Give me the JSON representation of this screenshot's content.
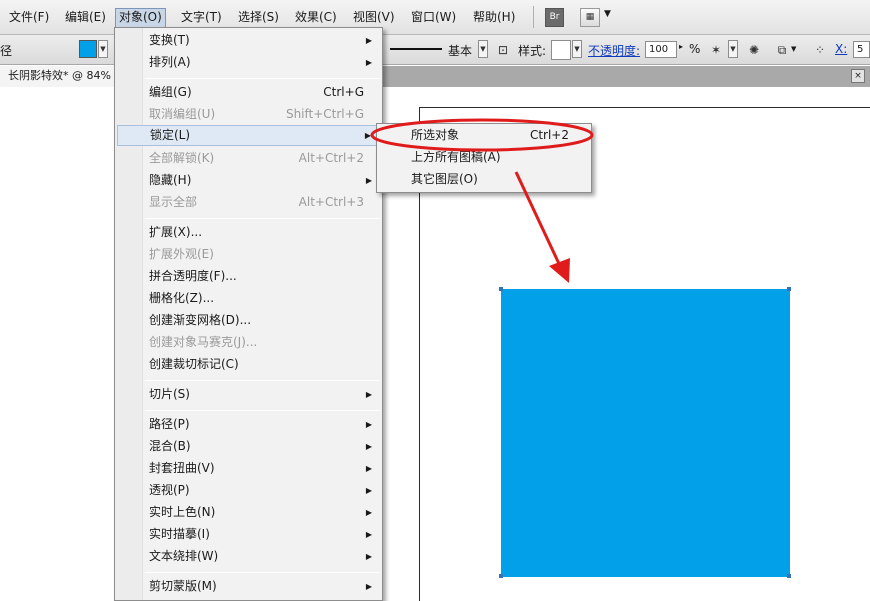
{
  "menubar": {
    "items": [
      "文件(F)",
      "编辑(E)",
      "对象(O)",
      "文字(T)",
      "选择(S)",
      "效果(C)",
      "视图(V)",
      "窗口(W)",
      "帮助(H)"
    ],
    "bridge_icon": "Br",
    "arrange_icon": "▦"
  },
  "controlbar": {
    "stroke_label_partial": "径",
    "brush_value": "基本",
    "style_label": "样式:",
    "opacity_label": "不透明度:",
    "opacity_value": "100",
    "opacity_unit": "%",
    "x_label": "X:",
    "x_value_partial": "5"
  },
  "document": {
    "tab_title": "长阴影特效* @ 84%",
    "close_glyph": "×"
  },
  "object_menu": {
    "items": [
      {
        "label": "变换(T)",
        "shortcut": "",
        "submenu": true,
        "disabled": false
      },
      {
        "label": "排列(A)",
        "shortcut": "",
        "submenu": true,
        "disabled": false
      },
      {
        "label": "编组(G)",
        "shortcut": "Ctrl+G",
        "submenu": false,
        "disabled": false
      },
      {
        "label": "取消编组(U)",
        "shortcut": "Shift+Ctrl+G",
        "submenu": false,
        "disabled": true
      },
      {
        "label": "锁定(L)",
        "shortcut": "",
        "submenu": true,
        "disabled": false
      },
      {
        "label": "全部解锁(K)",
        "shortcut": "Alt+Ctrl+2",
        "submenu": false,
        "disabled": true
      },
      {
        "label": "隐藏(H)",
        "shortcut": "",
        "submenu": true,
        "disabled": false
      },
      {
        "label": "显示全部",
        "shortcut": "Alt+Ctrl+3",
        "submenu": false,
        "disabled": true
      },
      {
        "label": "扩展(X)...",
        "shortcut": "",
        "submenu": false,
        "disabled": false
      },
      {
        "label": "扩展外观(E)",
        "shortcut": "",
        "submenu": false,
        "disabled": true
      },
      {
        "label": "拼合透明度(F)...",
        "shortcut": "",
        "submenu": false,
        "disabled": false
      },
      {
        "label": "栅格化(Z)...",
        "shortcut": "",
        "submenu": false,
        "disabled": false
      },
      {
        "label": "创建渐变网格(D)...",
        "shortcut": "",
        "submenu": false,
        "disabled": false
      },
      {
        "label": "创建对象马赛克(J)...",
        "shortcut": "",
        "submenu": false,
        "disabled": true
      },
      {
        "label": "创建裁切标记(C)",
        "shortcut": "",
        "submenu": false,
        "disabled": false
      },
      {
        "label": "切片(S)",
        "shortcut": "",
        "submenu": true,
        "disabled": false
      },
      {
        "label": "路径(P)",
        "shortcut": "",
        "submenu": true,
        "disabled": false
      },
      {
        "label": "混合(B)",
        "shortcut": "",
        "submenu": true,
        "disabled": false
      },
      {
        "label": "封套扭曲(V)",
        "shortcut": "",
        "submenu": true,
        "disabled": false
      },
      {
        "label": "透视(P)",
        "shortcut": "",
        "submenu": true,
        "disabled": false
      },
      {
        "label": "实时上色(N)",
        "shortcut": "",
        "submenu": true,
        "disabled": false
      },
      {
        "label": "实时描摹(I)",
        "shortcut": "",
        "submenu": true,
        "disabled": false
      },
      {
        "label": "文本绕排(W)",
        "shortcut": "",
        "submenu": true,
        "disabled": false
      },
      {
        "label": "剪切蒙版(M)",
        "shortcut": "",
        "submenu": true,
        "disabled": false
      }
    ]
  },
  "lock_submenu": {
    "items": [
      {
        "label": "所选对象",
        "shortcut": "Ctrl+2"
      },
      {
        "label": "上方所有图稿(A)",
        "shortcut": ""
      },
      {
        "label": "其它图层(O)",
        "shortcut": ""
      }
    ]
  },
  "colors": {
    "object_fill": "#02a0e9",
    "annotation_red": "#e01b1b",
    "menu_highlight": "#dfe9f6"
  },
  "glyphs": {
    "submenu_arrow": "▶",
    "dropdown_arrow": "▼",
    "stepper_arrow": "▸"
  }
}
